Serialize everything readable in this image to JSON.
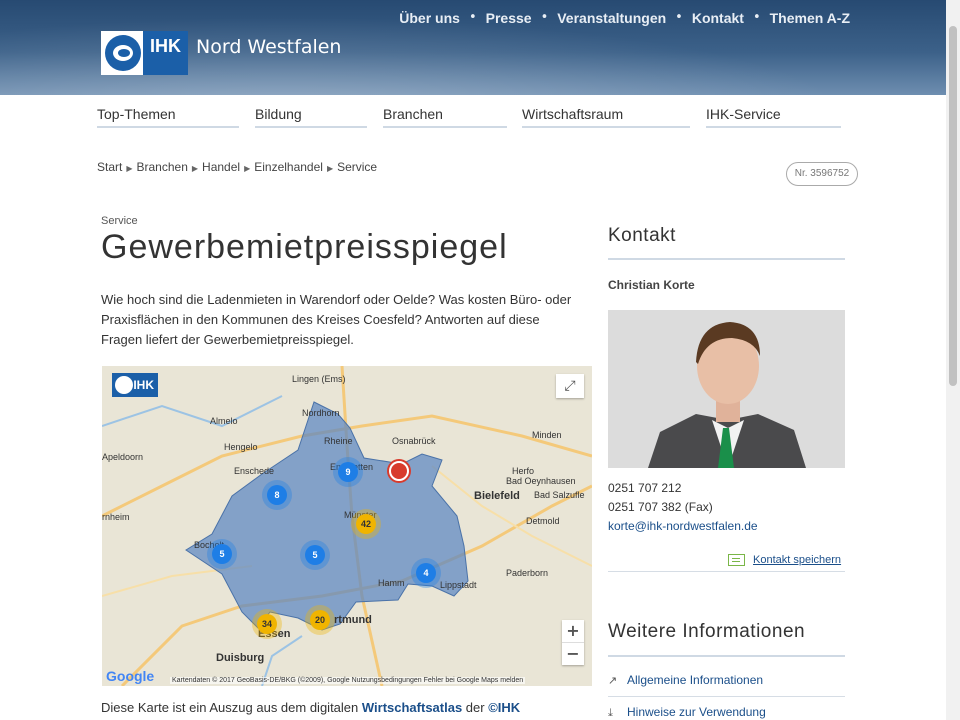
{
  "header": {
    "logo_text": "IHK",
    "org_name": "Nord Westfalen",
    "top_nav": [
      "Über uns",
      "Presse",
      "Veranstaltungen",
      "Kontakt",
      "Themen A-Z"
    ],
    "separator": "•"
  },
  "main_nav": [
    {
      "label": "Top-Themen"
    },
    {
      "label": "Bildung"
    },
    {
      "label": "Branchen"
    },
    {
      "label": "Wirtschaftsraum"
    },
    {
      "label": "IHK-Service"
    }
  ],
  "breadcrumb": [
    "Start",
    "Branchen",
    "Handel",
    "Einzelhandel",
    "Service"
  ],
  "doc_number": "Nr. 3596752",
  "content": {
    "section_label": "Service",
    "title": "Gewerbemietpreisspiegel",
    "intro": "Wie hoch sind die Ladenmieten in Warendorf oder Oelde? Was kosten Büro- oder Praxisflächen in den Kommunen des Kreises Coesfeld? Antworten auf diese Fragen liefert der Gewerbemietpreisspiegel.",
    "footnote_pre": "Diese Karte ist ein Auszug aus dem digitalen ",
    "footnote_link": "Wirtschaftsatlas",
    "footnote_mid": " der ",
    "footnote_link2": "©IHK"
  },
  "map": {
    "ihk_label": "IHK",
    "fullscreen_icon": "⤢",
    "zoom_in": "+",
    "zoom_out": "−",
    "google": "Google",
    "attribution": "Kartendaten © 2017 GeoBasis-DE/BKG (©2009), Google    Nutzungsbedingungen    Fehler bei Google Maps melden",
    "cities": {
      "lingen": "Lingen (Ems)",
      "nordhorn": "Nordhorn",
      "almelo": "Almelo",
      "hengelo": "Hengelo",
      "apeldoorn": "Apeldoorn",
      "enschede": "Enschede",
      "rheine": "Rheine",
      "osnabrueck": "Osnabrück",
      "minden": "Minden",
      "bielefeld": "Bielefeld",
      "badoeynhausen": "Bad Oeynhausen",
      "badsalzuflen": "Bad Salzufle",
      "detmold": "Detmold",
      "muenster": "Münster",
      "hamm": "Hamm",
      "lippstadt": "Lippstadt",
      "paderborn": "Paderborn",
      "dortmund": "rtmund",
      "essen": "Essen",
      "duisburg": "Duisburg",
      "herford": "Herfo",
      "emsdetten": "Emsdetten",
      "bocholt": "Bocholt",
      "arnheim": "rnheim"
    },
    "clusters": {
      "c9": "9",
      "c8": "8",
      "c42": "42",
      "c5a": "5",
      "c5b": "5",
      "c4": "4",
      "c34": "34",
      "c20": "20"
    }
  },
  "sidebar": {
    "contact_heading": "Kontakt",
    "contact_name": "Christian Korte",
    "phone": "0251 707 212",
    "fax": "0251 707 382 (Fax)",
    "email": "korte@ihk-nordwestfalen.de",
    "save_contact": "Kontakt speichern",
    "more_heading": "Weitere Informationen",
    "links": [
      "Allgemeine Informationen",
      "Hinweise zur Verwendung"
    ]
  },
  "colors": {
    "accent": "#1b4f8a",
    "brand": "#1b5fa8",
    "region": "#5b87c2"
  }
}
